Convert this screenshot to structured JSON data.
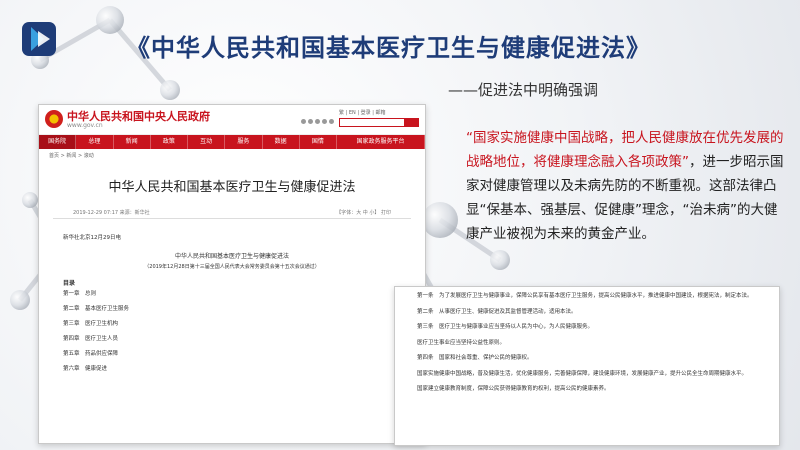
{
  "slide": {
    "title": "《中华人民共和国基本医疗卫生与健康促进法》",
    "subtitle": "——促进法中明确强调",
    "body_highlight": "“国家实施健康中国战略，把人民健康放在优先发展的战略地位，将健康理念融入各项政策”",
    "body_rest": "，进一步昭示国家对健康管理以及未病先防的不断重视。这部法律凸显“保基本、强基层、促健康”理念，“治未病”的大健康产业被视为未来的黄金产业。"
  },
  "gov_page": {
    "site_name": "中华人民共和国中央人民政府",
    "domain": "www.gov.cn",
    "lang_links": "繁 | EN | 登录 | 邮箱",
    "nav": [
      "国务院",
      "总理",
      "新闻",
      "政策",
      "互动",
      "服务",
      "数据",
      "国情",
      "国家政务服务平台"
    ],
    "breadcrumb": "首页 > 新闻 > 滚动",
    "article_title": "中华人民共和国基本医疗卫生与健康促进法",
    "meta_left": "2019-12-29 07:17    来源：新华社",
    "meta_right": "【字体：大 中 小】   打印",
    "dateline": "新华社北京12月29日电",
    "law_name": "中华人民共和国基本医疗卫生与健康促进法",
    "law_note": "（2019年12月28日第十三届全国人民代表大会常务委员会第十五次会议通过）",
    "toc_heading": "目录",
    "toc": [
      "第一章　总则",
      "第二章　基本医疗卫生服务",
      "第三章　医疗卫生机构",
      "第四章　医疗卫生人员",
      "第五章　药品供应保障",
      "第六章　健康促进"
    ]
  },
  "law_text": {
    "paragraphs": [
      "第一条　为了发展医疗卫生与健康事业，保障公民享有基本医疗卫生服务，提高公民健康水平，推进健康中国建设，根据宪法，制定本法。",
      "第二条　从事医疗卫生、健康促进及其监督管理活动，适用本法。",
      "第三条　医疗卫生与健康事业应当坚持以人民为中心，为人民健康服务。",
      "医疗卫生事业应当坚持公益性原则。",
      "第四条　国家和社会尊重、保护公民的健康权。",
      "国家实施健康中国战略，普及健康生活，优化健康服务，完善健康保障，建设健康环境，发展健康产业，提升公民全生命周期健康水平。",
      "国家建立健康教育制度，保障公民获得健康教育的权利，提高公民的健康素养。"
    ]
  },
  "colors": {
    "title": "#1e3c78",
    "highlight": "#c8141e",
    "gov_red": "#c8141e"
  }
}
